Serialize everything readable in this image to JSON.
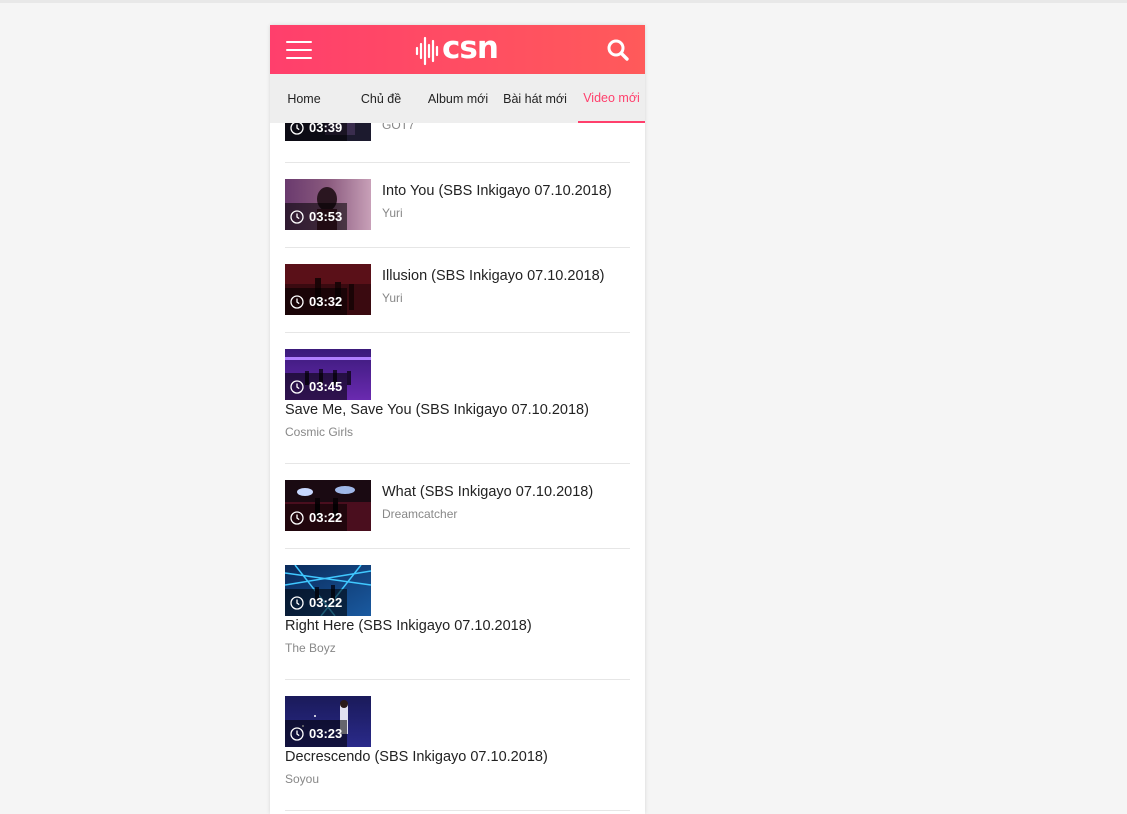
{
  "header": {
    "logo_text": "csn",
    "menu_icon": "hamburger-menu-icon",
    "search_icon": "search-icon",
    "accent_color": "#ff3f6c"
  },
  "tabs": [
    {
      "label": "Home"
    },
    {
      "label": "Chủ đề"
    },
    {
      "label": "Album mới"
    },
    {
      "label": "Bài hát mới"
    },
    {
      "label": "Video mới",
      "active": true
    }
  ],
  "videos": [
    {
      "title": "",
      "artist": "GOT7",
      "duration": "03:39"
    },
    {
      "title": "Into You (SBS Inkigayo 07.10.2018)",
      "artist": "Yuri",
      "duration": "03:53"
    },
    {
      "title": "Illusion (SBS Inkigayo 07.10.2018)",
      "artist": "Yuri",
      "duration": "03:32"
    },
    {
      "title": "Save Me, Save You (SBS Inkigayo 07.10.2018)",
      "artist": "Cosmic Girls",
      "duration": "03:45"
    },
    {
      "title": "What (SBS Inkigayo 07.10.2018)",
      "artist": "Dreamcatcher",
      "duration": "03:22"
    },
    {
      "title": "Right Here (SBS Inkigayo 07.10.2018)",
      "artist": "The Boyz",
      "duration": "03:22"
    },
    {
      "title": "Decrescendo (SBS Inkigayo 07.10.2018)",
      "artist": "Soyou",
      "duration": "03:23"
    }
  ]
}
